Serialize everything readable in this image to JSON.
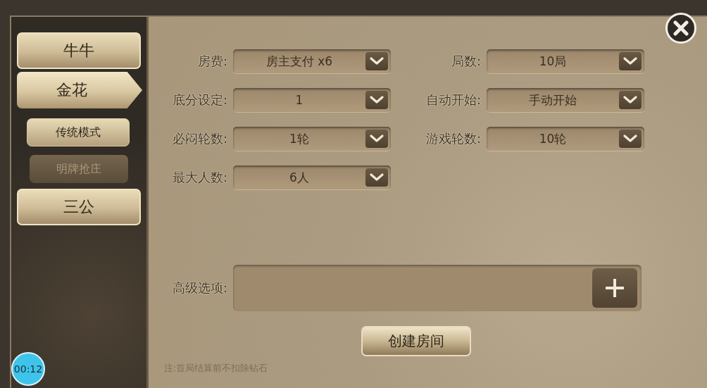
{
  "sidebar": {
    "items": [
      {
        "label": "牛牛",
        "selected": false
      },
      {
        "label": "金花",
        "selected": true,
        "children": [
          {
            "label": "传统模式",
            "selected": true
          },
          {
            "label": "明牌抢庄",
            "selected": false
          }
        ]
      },
      {
        "label": "三公",
        "selected": false
      }
    ]
  },
  "settings": [
    {
      "label": "房费:",
      "value": "房主支付 x6"
    },
    {
      "label": "局数:",
      "value": "10局"
    },
    {
      "label": "底分设定:",
      "value": "1"
    },
    {
      "label": "自动开始:",
      "value": "手动开始"
    },
    {
      "label": "必闷轮数:",
      "value": "1轮"
    },
    {
      "label": "游戏轮数:",
      "value": "10轮"
    },
    {
      "label": "最大人数:",
      "value": "6人"
    }
  ],
  "advanced": {
    "label": "高级选项:"
  },
  "create_button": {
    "label": "创建房间"
  },
  "note": "注:首局结算前不扣除钻石",
  "timer": "00:12"
}
